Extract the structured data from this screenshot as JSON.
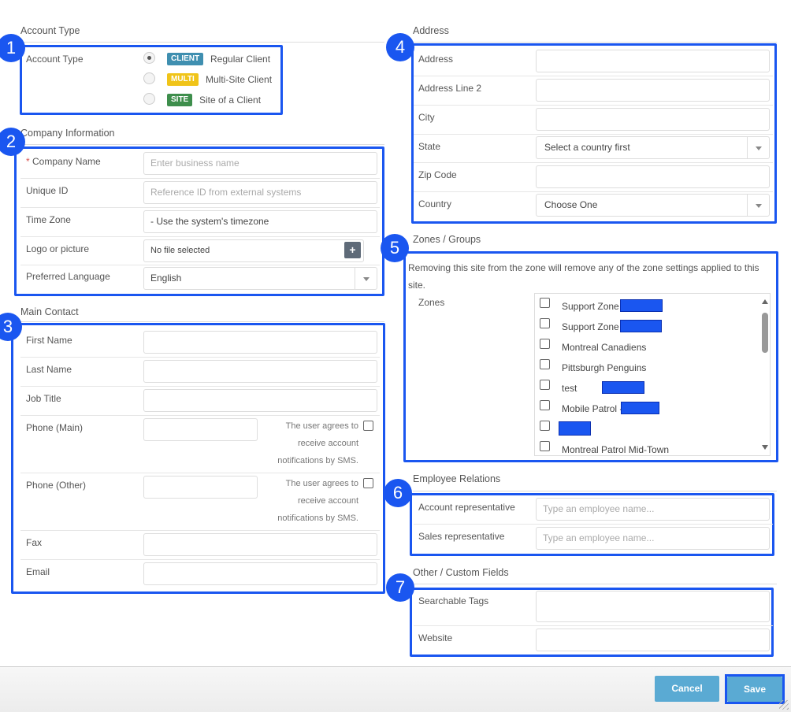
{
  "account_type": {
    "section_title": "Account Type",
    "label": "Account Type",
    "options": [
      {
        "tag": "CLIENT",
        "tag_color": "#3f8fb0",
        "label": "Regular Client",
        "selected": true
      },
      {
        "tag": "MULTI",
        "tag_color": "#f0c419",
        "label": "Multi-Site Client",
        "selected": false
      },
      {
        "tag": "SITE",
        "tag_color": "#3e8e4c",
        "label": "Site of a Client",
        "selected": false
      }
    ]
  },
  "company": {
    "section_title": "Company Information",
    "required_mark": "*",
    "company_name_label": "Company Name",
    "company_name_placeholder": "Enter business name",
    "unique_id_label": "Unique ID",
    "unique_id_placeholder": "Reference ID from external systems",
    "time_zone_label": "Time Zone",
    "time_zone_value": "- Use the system's timezone",
    "logo_label": "Logo or picture",
    "logo_value": "No file selected",
    "logo_button": "+",
    "language_label": "Preferred Language",
    "language_value": "English"
  },
  "main_contact": {
    "section_title": "Main Contact",
    "first_name_label": "First Name",
    "last_name_label": "Last Name",
    "job_title_label": "Job Title",
    "phone_main_label": "Phone (Main)",
    "phone_other_label": "Phone (Other)",
    "sms_line1": "The user agrees to",
    "sms_line2": "receive account",
    "sms_line3": "notifications by SMS.",
    "fax_label": "Fax",
    "email_label": "Email"
  },
  "address": {
    "section_title": "Address",
    "address_label": "Address",
    "address2_label": "Address Line 2",
    "city_label": "City",
    "state_label": "State",
    "state_value": "Select a country first",
    "zip_label": "Zip Code",
    "country_label": "Country",
    "country_value": "Choose One"
  },
  "zones": {
    "section_title": "Zones / Groups",
    "notice_line1": "Removing this site from the zone will remove any of the zone settings applied to this",
    "notice_line2": "site.",
    "label": "Zones",
    "items": [
      {
        "label": "Support Zone",
        "redacted": true
      },
      {
        "label": "Support Zone",
        "redacted": true
      },
      {
        "label": "Montreal Canadiens",
        "redacted": false
      },
      {
        "label": "Pittsburgh Penguins",
        "redacted": false
      },
      {
        "label": "test",
        "redacted": true
      },
      {
        "label": "Mobile Patrol -",
        "redacted": true
      },
      {
        "label": "",
        "redacted": true
      },
      {
        "label": "Montreal Patrol Mid-Town",
        "redacted": false
      }
    ]
  },
  "employee_relations": {
    "section_title": "Employee Relations",
    "account_rep_label": "Account representative",
    "account_rep_placeholder": "Type an employee name...",
    "sales_rep_label": "Sales representative",
    "sales_rep_placeholder": "Type an employee name..."
  },
  "custom_fields": {
    "section_title": "Other / Custom Fields",
    "tags_label": "Searchable Tags",
    "website_label": "Website"
  },
  "footer": {
    "cancel_label": "Cancel",
    "save_label": "Save"
  },
  "annotations": [
    "1",
    "2",
    "3",
    "4",
    "5",
    "6",
    "7"
  ],
  "colors": {
    "highlight": "#1a56f0",
    "button": "#5aaad3"
  }
}
